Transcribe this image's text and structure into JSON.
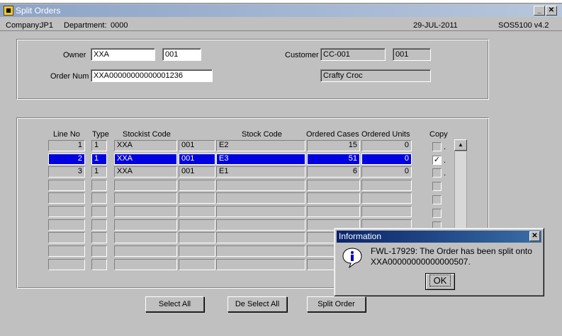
{
  "window": {
    "title": "Split Orders",
    "icon": "app-icon"
  },
  "status": {
    "company_label": "Company:",
    "company": "JP1",
    "department_label": "Department:",
    "department": "0000",
    "date": "29-JUL-2011",
    "program": "SOS5100  v4.2"
  },
  "header": {
    "owner_label": "Owner",
    "owner": "XXA",
    "owner_code": "001",
    "customer_label": "Customer",
    "customer": "CC-001",
    "customer_code": "001",
    "order_label": "Order Num",
    "order_num": "XXA00000000000001236",
    "customer_name": "Crafty Croc"
  },
  "columns": {
    "line_no": "Line No",
    "type": "Type",
    "stockist": "Stockist Code",
    "stock": "Stock Code",
    "cases": "Ordered Cases",
    "units": "Ordered Units",
    "copy": "Copy"
  },
  "rows": [
    {
      "line": "1",
      "type": "1",
      "stockist": "XXA",
      "stockist_code": "001",
      "stock": "E2",
      "cases": "15",
      "units": "0",
      "copy": ""
    },
    {
      "line": "2",
      "type": "1",
      "stockist": "XXA",
      "stockist_code": "001",
      "stock": "E3",
      "cases": "51",
      "units": "0",
      "copy": "✓"
    },
    {
      "line": "3",
      "type": "1",
      "stockist": "XXA",
      "stockist_code": "001",
      "stock": "E1",
      "cases": "6",
      "units": "0",
      "copy": ""
    }
  ],
  "buttons": {
    "select_all": "Select All",
    "deselect_all": "De Select All",
    "split_order": "Split Order"
  },
  "dialog": {
    "title": "Information",
    "message_line1": "FWL-17929:  The Order has been split onto",
    "message_line2": "XXA00000000000000507.",
    "ok": "OK",
    "icon": "info-icon"
  }
}
